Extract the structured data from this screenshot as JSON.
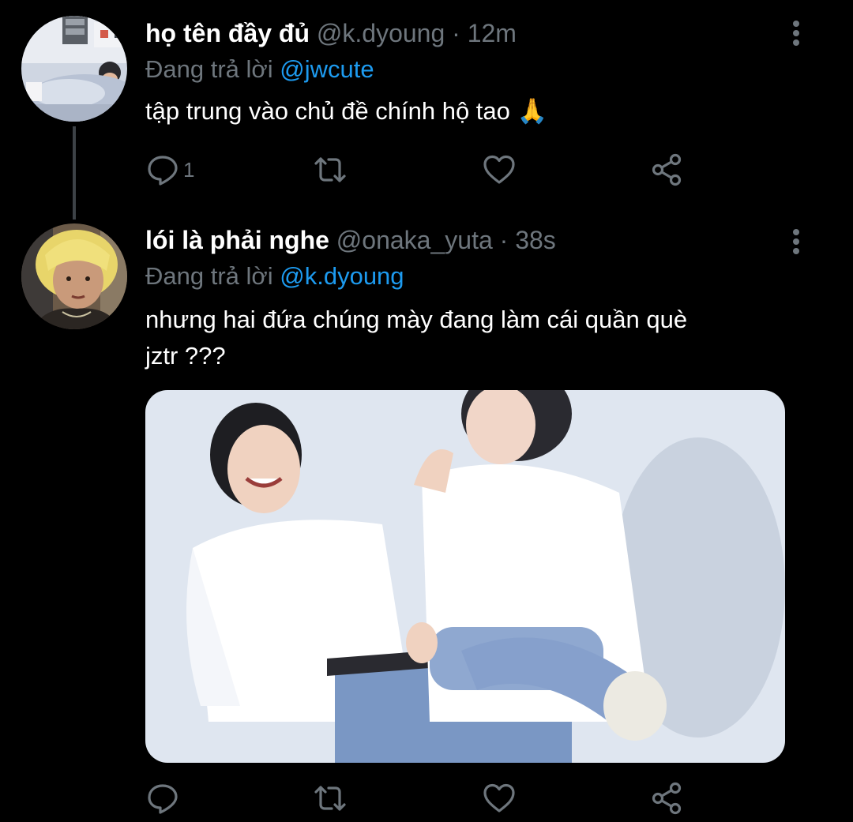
{
  "tweets": [
    {
      "author_name": "họ tên đầy đủ",
      "handle": "@k.dyoung",
      "separator": "·",
      "time": "12m",
      "replying_prefix": "Đang trả lời",
      "replying_to": "@jwcute",
      "text": "tập trung vào chủ đề chính hộ tao 🙏",
      "reply_count": "1",
      "avatar_icon": "avatar-photo-person-in-bed"
    },
    {
      "author_name": "lói là phải nghe",
      "handle": "@onaka_yuta",
      "separator": "·",
      "time": "38s",
      "replying_prefix": "Đang trả lời",
      "replying_to": "@k.dyoung",
      "text_line1": "nhưng hai đứa chúng mày đang làm cái quần què",
      "text_line2": "jztr ???",
      "reply_count": "",
      "avatar_icon": "avatar-photo-blond-person",
      "media_icon": "photo-two-people-white-tshirts"
    }
  ],
  "colors": {
    "background": "#000000",
    "primary_text": "#ffffff",
    "secondary_text": "#6e767d",
    "mention": "#1d9bf0",
    "thread_line": "#3d4247"
  }
}
